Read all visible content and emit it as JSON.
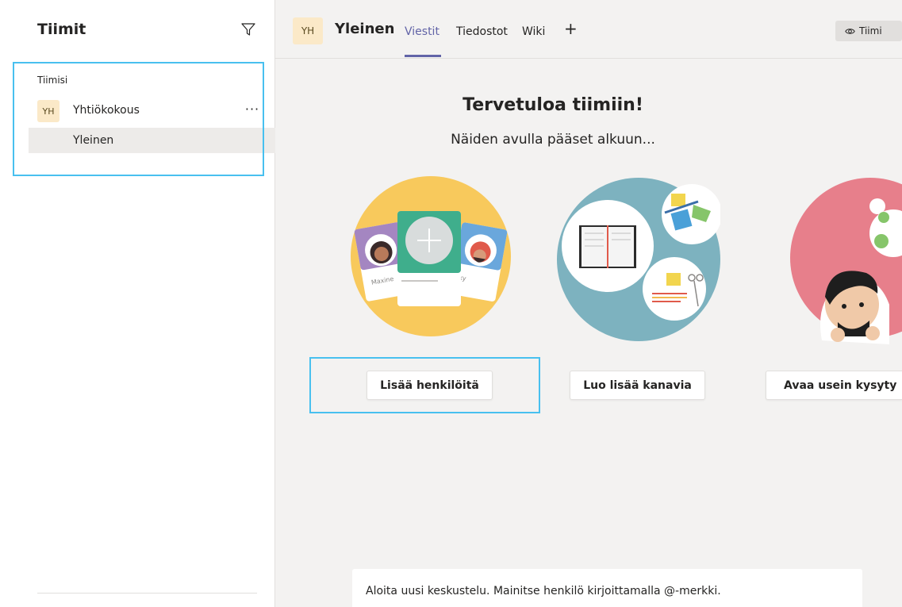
{
  "sidebar": {
    "title": "Tiimit",
    "section_label": "Tiimisi",
    "team": {
      "initials": "YH",
      "name": "Yhtiökokous",
      "more": "···"
    },
    "channel": {
      "name": "Yleinen"
    }
  },
  "header": {
    "initials": "YH",
    "channel_title": "Yleinen",
    "tabs": [
      {
        "label": "Viestit",
        "active": true
      },
      {
        "label": "Tiedostot",
        "active": false
      },
      {
        "label": "Wiki",
        "active": false
      }
    ],
    "add_tab": "+",
    "team_button": "Tiimi"
  },
  "main": {
    "title": "Tervetuloa tiimiin!",
    "subtitle": "Näiden avulla pääset alkuun...",
    "cards": [
      {
        "button": "Lisää henkilöitä",
        "illustration": "add-people"
      },
      {
        "button": "Luo lisää kanavia",
        "illustration": "create-channels"
      },
      {
        "button": "Avaa usein kysyty",
        "illustration": "faq"
      }
    ],
    "illustration_names": {
      "left": "Maxine",
      "right": "ky"
    }
  },
  "compose": {
    "placeholder": "Aloita uusi keskustelu. Mainitse henkilö kirjoittamalla @-merkki."
  },
  "colors": {
    "accent": "#6264a7",
    "highlight": "#48c0ef",
    "avatar_bg": "#fbe9c8",
    "illu_yellow": "#f8c95c",
    "illu_teal": "#7db2bf",
    "illu_pink": "#e77f8b"
  }
}
